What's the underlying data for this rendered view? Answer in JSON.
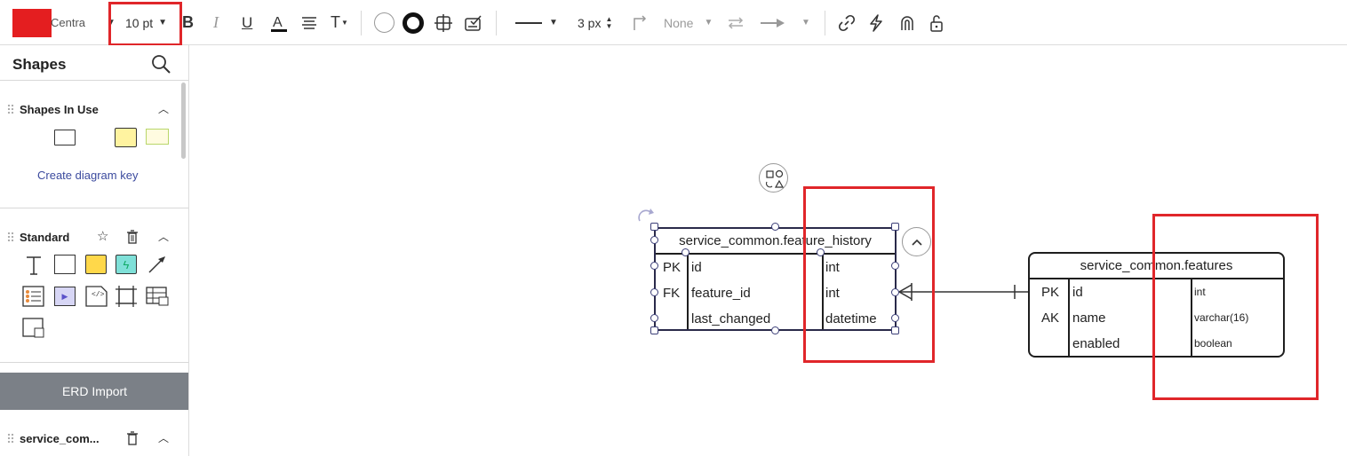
{
  "toolbar": {
    "fill_color": "#e41e20",
    "font_name": "Centra",
    "font_size": "10 pt",
    "line_width": "3 px",
    "line_start": "None"
  },
  "sidebar": {
    "title": "Shapes",
    "shapes_in_use": {
      "label": "Shapes In Use",
      "create_key": "Create diagram key"
    },
    "standard": {
      "label": "Standard"
    },
    "erd_import": "ERD Import",
    "bottom_section": "service_com..."
  },
  "diagram": {
    "table1": {
      "title": "service_common.feature_history",
      "rows": [
        {
          "key": "PK",
          "name": "id",
          "type": "int"
        },
        {
          "key": "FK",
          "name": "feature_id",
          "type": "int"
        },
        {
          "key": "",
          "name": "last_changed",
          "type": "datetime"
        }
      ]
    },
    "table2": {
      "title": "service_common.features",
      "rows": [
        {
          "key": "PK",
          "name": "id",
          "type": "int"
        },
        {
          "key": "AK",
          "name": "name",
          "type": "varchar(16)"
        },
        {
          "key": "",
          "name": "enabled",
          "type": "boolean"
        }
      ]
    }
  },
  "colors": {
    "accent_red": "#e0262a",
    "selection": "#3c3f78",
    "link": "#3b4a9e"
  }
}
